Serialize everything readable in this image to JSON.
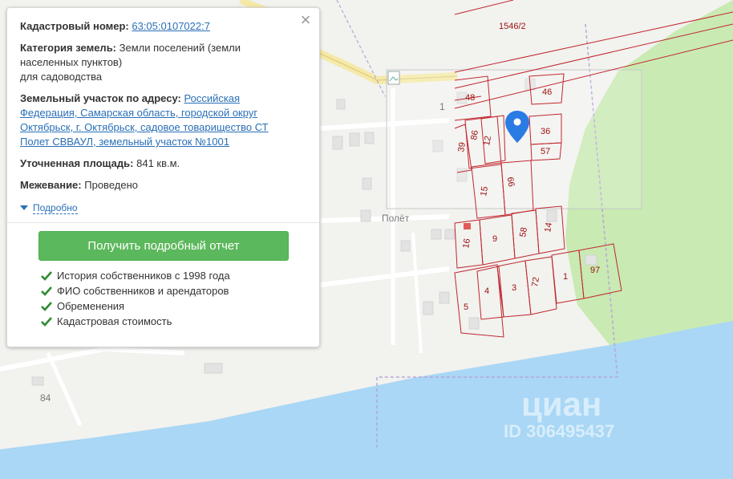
{
  "panel": {
    "cadastral_label": "Кадастровый номер:",
    "cadastral_number": "63:05:0107022:7",
    "category_label": "Категория земель:",
    "category_value_line1": "Земли поселений (земли",
    "category_value_line2": "населенных пунктов)",
    "category_value_line3": "для садоводства",
    "address_label": "Земельный участок по адресу:",
    "address_line1": "Российская",
    "address_line2": "Федерация, Самарская область, городской округ",
    "address_line3": "Октябрьск, г. Октябрьск, садовое товарищество СТ",
    "address_line4": "Полет СВВАУЛ, земельный участок №1001",
    "area_label": "Уточненная площадь:",
    "area_value": "841 кв.м.",
    "survey_label": "Межевание:",
    "survey_value": "Проведено",
    "details_link": "Подробно",
    "report_button": "Получить подробный отчет",
    "features": [
      "История собственников с 1998 года",
      "ФИО собственников и арендаторов",
      "Обременения",
      "Кадастровая стоимость"
    ]
  },
  "map": {
    "place_label": "Полёт",
    "house_number_1": "1",
    "house_number_84": "84",
    "plot_number_top": "1546/2",
    "plot_labels": [
      "48",
      "46",
      "86",
      "12",
      "36",
      "39",
      "57",
      "15",
      "99",
      "16",
      "9",
      "58",
      "14",
      "4",
      "3",
      "72",
      "1",
      "97",
      "5"
    ],
    "watermark_logo": "циан",
    "watermark_id": "ID 306495437",
    "colors": {
      "water": "#a9d7f5",
      "forest": "#c9eab3",
      "plot_border": "#c0272d",
      "marker": "#2a7be4"
    }
  }
}
